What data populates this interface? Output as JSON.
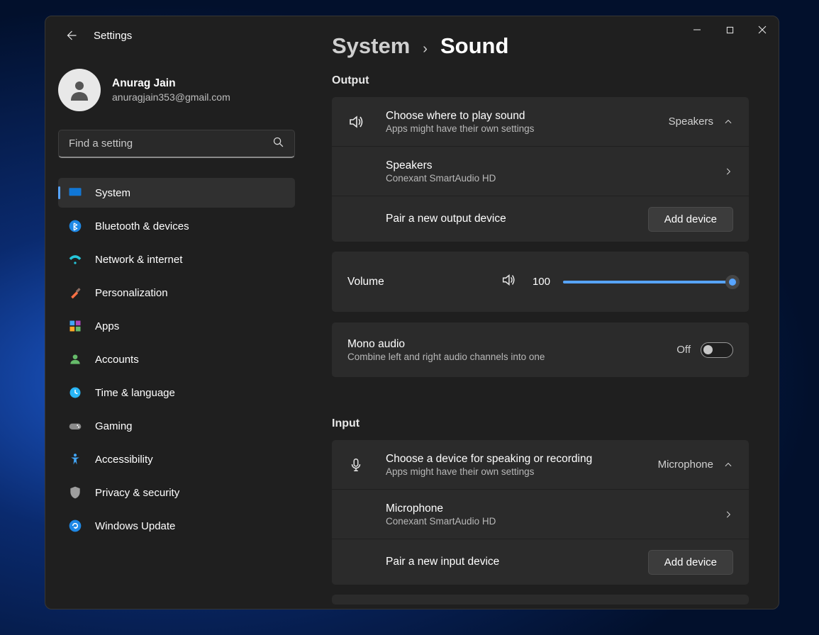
{
  "app_title": "Settings",
  "profile": {
    "name": "Anurag Jain",
    "email": "anuragjain353@gmail.com"
  },
  "search": {
    "placeholder": "Find a setting"
  },
  "nav": {
    "items": [
      {
        "label": "System"
      },
      {
        "label": "Bluetooth & devices"
      },
      {
        "label": "Network & internet"
      },
      {
        "label": "Personalization"
      },
      {
        "label": "Apps"
      },
      {
        "label": "Accounts"
      },
      {
        "label": "Time & language"
      },
      {
        "label": "Gaming"
      },
      {
        "label": "Accessibility"
      },
      {
        "label": "Privacy & security"
      },
      {
        "label": "Windows Update"
      }
    ]
  },
  "breadcrumb": {
    "parent": "System",
    "current": "Sound"
  },
  "output": {
    "section": "Output",
    "choose": {
      "title": "Choose where to play sound",
      "sub": "Apps might have their own settings",
      "value": "Speakers"
    },
    "device": {
      "title": "Speakers",
      "sub": "Conexant SmartAudio HD"
    },
    "pair": {
      "title": "Pair a new output device",
      "button": "Add device"
    },
    "volume": {
      "label": "Volume",
      "value": "100"
    },
    "mono": {
      "title": "Mono audio",
      "sub": "Combine left and right audio channels into one",
      "state": "Off"
    }
  },
  "input": {
    "section": "Input",
    "choose": {
      "title": "Choose a device for speaking or recording",
      "sub": "Apps might have their own settings",
      "value": "Microphone"
    },
    "device": {
      "title": "Microphone",
      "sub": "Conexant SmartAudio HD"
    },
    "pair": {
      "title": "Pair a new input device",
      "button": "Add device"
    }
  }
}
